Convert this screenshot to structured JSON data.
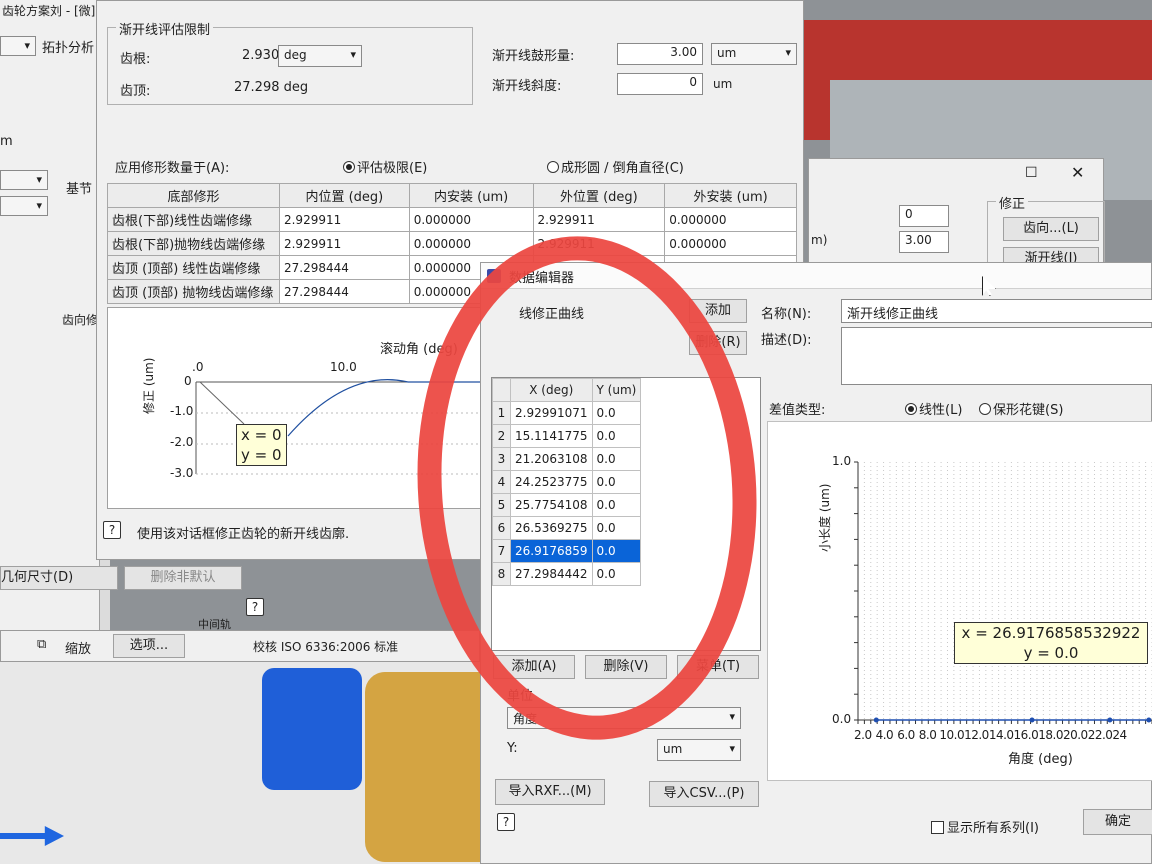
{
  "window_top": {
    "title_fragment": "齿轮方案刘 - [微]",
    "topology_label": "拓扑分析",
    "trunc_o": "m",
    "foundation_tab": "基节",
    "tooth_label": "齿向修",
    "geom_size_button": "几何尺寸(D)",
    "delete_button": "删除非默认",
    "zoom_label": "缩放",
    "options_button": "选项...",
    "middle_label": "中间轨"
  },
  "involute_dialog": {
    "group_title": "渐开线评估限制",
    "root_label": "齿根:",
    "root_value": "2.930",
    "root_unit": "deg",
    "tip_label": "齿顶:",
    "tip_value": "27.298 deg",
    "crown_label": "渐开线鼓形量:",
    "crown_value": "3.00",
    "crown_unit": "um",
    "slope_label": "渐开线斜度:",
    "slope_value": "0",
    "slope_unit": "um",
    "apply_label": "应用修形数量于(A):",
    "radio_eval": "评估极限(E)",
    "radio_form": "成形圆 / 倒角直径(C)",
    "table": {
      "headers": [
        "底部修形",
        "内位置 (deg)",
        "内安装 (um)",
        "外位置 (deg)",
        "外安装 (um)"
      ],
      "rows": [
        [
          "齿根(下部)线性齿端修缘",
          "2.929911",
          "0.000000",
          "2.929911",
          "0.000000"
        ],
        [
          "齿根(下部)抛物线齿端修缘",
          "2.929911",
          "0.000000",
          "2.929911",
          "0.000000"
        ],
        [
          "齿顶 (顶部) 线性齿端修缘",
          "27.298444",
          "0.000000",
          "",
          "0.000000"
        ],
        [
          "齿顶 (顶部) 抛物线齿端修缘",
          "27.298444",
          "0.000000",
          "",
          ""
        ]
      ]
    },
    "plot": {
      "axis_title": "滚动角 (deg)",
      "xtick_0": ".0",
      "xtick_10": "10.0",
      "ylabel": "修正 (um)",
      "yticks": [
        "0",
        "-1.0",
        "-2.0",
        "-3.0"
      ],
      "tip_x": "x = 0",
      "tip_y": "y = 0"
    },
    "help_text": "使用该对话框修正齿轮的新开线齿廓.",
    "footer_text": "校核 ISO 6336:2006 标准"
  },
  "right_window": {
    "group_title": "修正",
    "row1_value": "0",
    "row2_label": "m)",
    "row2_value": "3.00",
    "toothdir_button": "齿向...(L)",
    "involute_button": "渐开线(I)"
  },
  "editor_dialog": {
    "title": "数据编辑器",
    "list_item": "线修正曲线",
    "add_top": "添加",
    "delete_top": "删除(R)",
    "name_label": "名称(N):",
    "name_value": "渐开线修正曲线",
    "desc_label": "描述(D):",
    "interp_label": "差值类型:",
    "radio_linear": "线性(L)",
    "radio_spline": "保形花键(S)",
    "col_x": "X (deg)",
    "col_y": "Y (um)",
    "points": [
      {
        "i": "1",
        "x": "2.92991071",
        "y": "0.0"
      },
      {
        "i": "2",
        "x": "15.1141775",
        "y": "0.0"
      },
      {
        "i": "3",
        "x": "21.2063108",
        "y": "0.0"
      },
      {
        "i": "4",
        "x": "24.2523775",
        "y": "0.0"
      },
      {
        "i": "5",
        "x": "25.7754108",
        "y": "0.0"
      },
      {
        "i": "6",
        "x": "26.5369275",
        "y": "0.0"
      },
      {
        "i": "7",
        "x": "26.9176859",
        "y": "0.0"
      },
      {
        "i": "8",
        "x": "27.2984442",
        "y": "0.0"
      }
    ],
    "add_button": "添加(A)",
    "delete_button": "删除(V)",
    "third_button": "菜单(T)",
    "unit_group": "单位",
    "x_unit": "角度",
    "y_label": "Y:",
    "y_unit": "um",
    "import_rxf": "导入RXF...(M)",
    "import_csv": "导入CSV...(P)",
    "show_all": "显示所有系列(I)",
    "ok_button": "确定",
    "chart": {
      "ylabel": "小长度 (um)",
      "xlabel": "角度 (deg)",
      "ytick_top": "1.0",
      "ytick_bottom": "0.0",
      "xticks": [
        "2.0",
        "4.0",
        "6.0",
        "8.0",
        "10.0",
        "12.0",
        "14.0",
        "16.0",
        "18.0",
        "20.0",
        "22.0",
        "24"
      ],
      "tip_x": "x = 26.9176858532922",
      "tip_y": "y = 0.0"
    }
  },
  "chart_data": {
    "type": "scatter",
    "x": [
      2.92991071,
      15.1141775,
      21.2063108,
      24.2523775,
      25.7754108,
      26.5369275,
      26.9176859,
      27.2984442
    ],
    "y": [
      0.0,
      0.0,
      0.0,
      0.0,
      0.0,
      0.0,
      0.0,
      0.0
    ],
    "xlabel": "角度 (deg)",
    "ylabel": "小长度 (um)",
    "ylim": [
      0.0,
      1.0
    ]
  }
}
